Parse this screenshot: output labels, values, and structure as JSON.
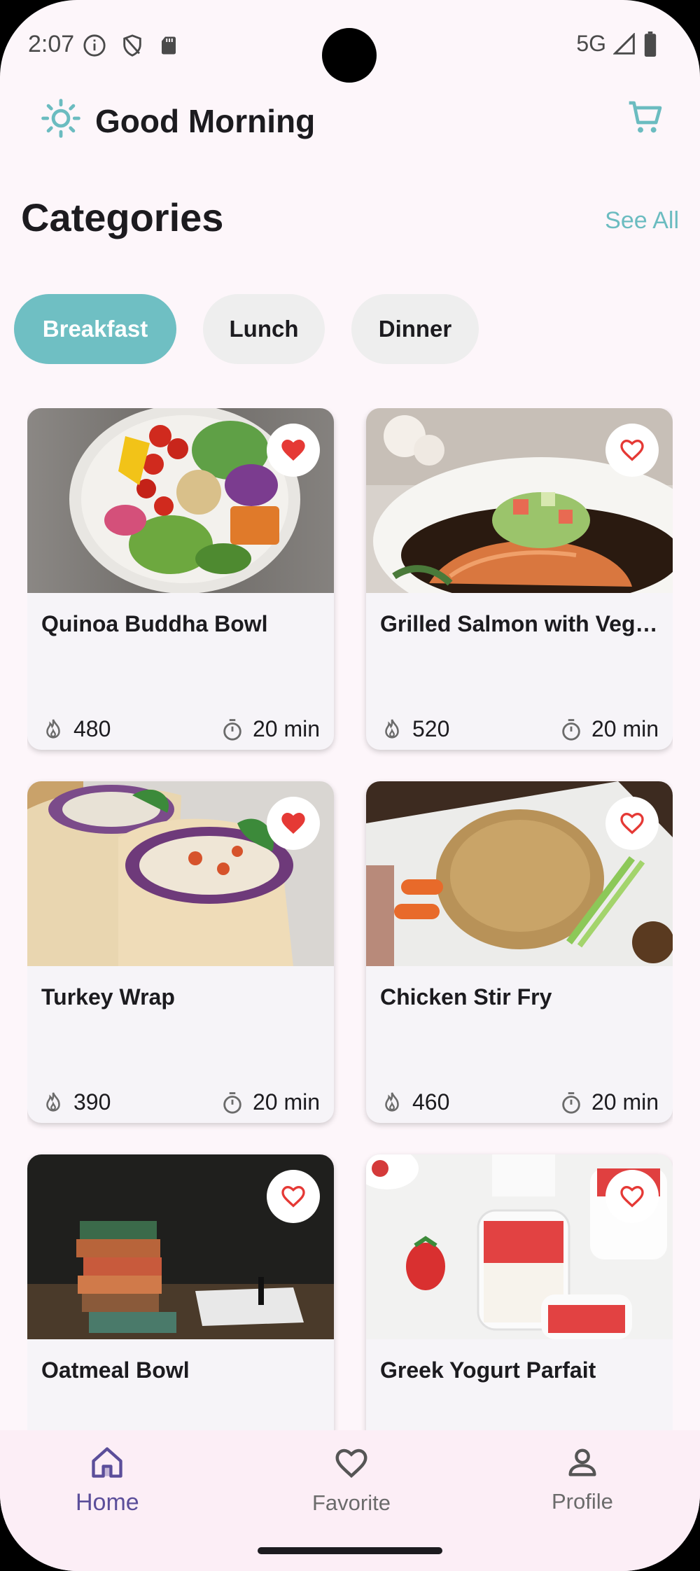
{
  "status": {
    "time": "2:07",
    "network": "5G"
  },
  "header": {
    "greeting": "Good Morning"
  },
  "categories": {
    "title": "Categories",
    "see_all": "See All",
    "chips": [
      "Breakfast",
      "Lunch",
      "Dinner"
    ],
    "active": "Breakfast"
  },
  "recipes": [
    {
      "name": "Quinoa Buddha Bowl",
      "calories": "480",
      "time": "20 min",
      "favorite": true
    },
    {
      "name": "Grilled Salmon with Vegetables",
      "calories": "520",
      "time": "20 min",
      "favorite": false
    },
    {
      "name": "Turkey Wrap",
      "calories": "390",
      "time": "20 min",
      "favorite": true
    },
    {
      "name": "Chicken Stir Fry",
      "calories": "460",
      "time": "20 min",
      "favorite": false
    },
    {
      "name": "Oatmeal Bowl",
      "calories": "",
      "time": "",
      "favorite": false
    },
    {
      "name": "Greek Yogurt Parfait",
      "calories": "",
      "time": "",
      "favorite": false
    }
  ],
  "nav": {
    "home": "Home",
    "favorite": "Favorite",
    "profile": "Profile"
  },
  "colors": {
    "accent": "#6fbfc3",
    "heart": "#e53935",
    "nav_active": "#5b4e9a"
  }
}
